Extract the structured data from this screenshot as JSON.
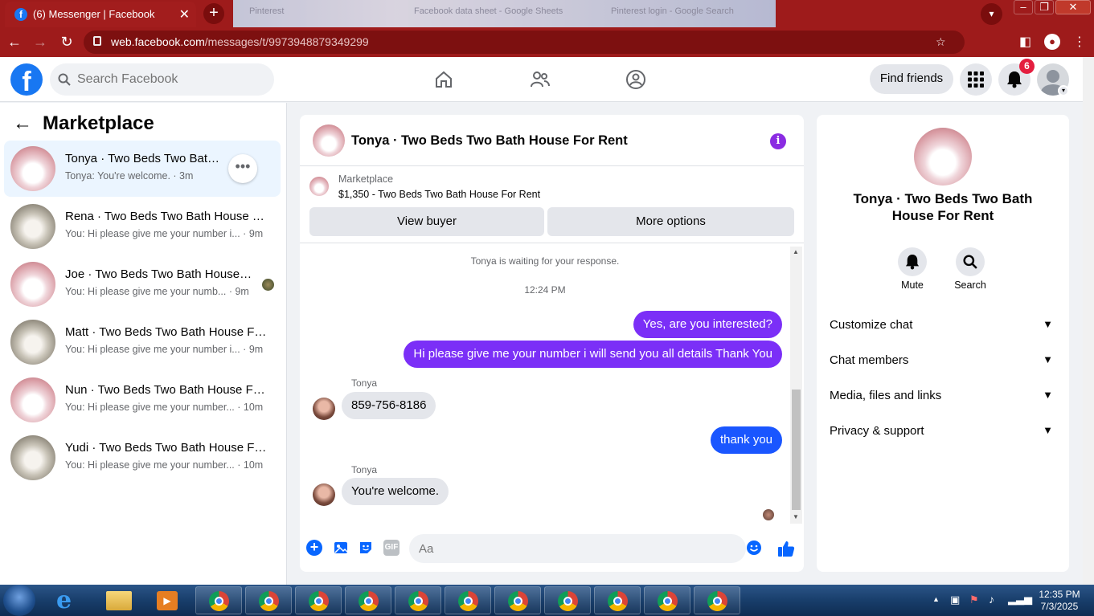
{
  "browser": {
    "active_tab_title": "(6) Messenger | Facebook",
    "background_tabs": [
      "Pinterest",
      "Facebook data sheet - Google Sheets",
      "Pinterest login - Google Search"
    ],
    "url_host": "web.facebook.com",
    "url_path": "/messages/t/9973948879349299",
    "accent": "#9e1b1b"
  },
  "facebook": {
    "logo_letter": "f",
    "search_placeholder": "Search Facebook",
    "find_friends": "Find friends",
    "notification_count": "6",
    "brand_color": "#1877f2"
  },
  "sidebar": {
    "title": "Marketplace",
    "conversations": [
      {
        "name": "Tonya · Two Beds Two Bath House For Rent",
        "preview": "Tonya: You're welcome. · 3m",
        "selected": true
      },
      {
        "name": "Rena · Two Beds Two Bath House For Rent",
        "preview": "You: Hi please give me your number i... · 9m"
      },
      {
        "name": "Joe · Two Beds Two Bath House For Rent",
        "preview": "You: Hi please give me your numb... · 9m"
      },
      {
        "name": "Matt · Two Beds Two Bath House For Rent",
        "preview": "You: Hi please give me your number i... · 9m"
      },
      {
        "name": "Nun · Two Beds Two Bath House For Rent",
        "preview": "You: Hi please give me your number... · 10m"
      },
      {
        "name": "Yudi · Two Beds Two Bath House For Rent",
        "preview": "You: Hi please give me your number... · 10m"
      }
    ]
  },
  "chat": {
    "title": "Tonya · Two Beds Two Bath House For Rent",
    "listing_source": "Marketplace",
    "listing_text": "$1,350 - Two Beds Two Bath House For Rent",
    "view_buyer": "View buyer",
    "more_options": "More options",
    "waiting_notice": "Tonya is waiting for your response.",
    "timestamp": "12:24 PM",
    "messages": [
      {
        "from": "me",
        "text": "Yes, are you interested?"
      },
      {
        "from": "me",
        "text": "Hi please give me your number i will send you all details Thank You"
      },
      {
        "from": "Tonya",
        "sender_label": "Tonya",
        "text": "859-756-8186"
      },
      {
        "from": "me",
        "text": "thank you"
      },
      {
        "from": "Tonya",
        "sender_label": "Tonya",
        "text": "You're welcome."
      }
    ],
    "composer_placeholder": "Aa",
    "gif_label": "GIF",
    "outgoing_color": "#7b2ff7"
  },
  "details": {
    "title": "Tonya · Two Beds Two Bath House For Rent",
    "mute": "Mute",
    "search": "Search",
    "sections": [
      "Customize chat",
      "Chat members",
      "Media, files and links",
      "Privacy & support"
    ]
  },
  "taskbar": {
    "time": "12:35 PM",
    "date": "7/3/2025"
  }
}
